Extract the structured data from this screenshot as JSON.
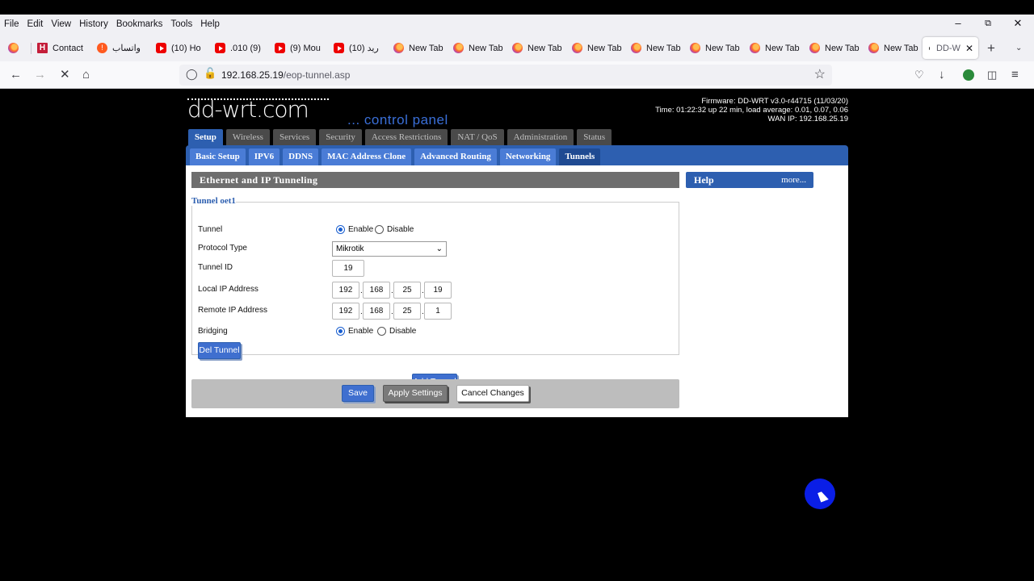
{
  "menubar": {
    "items": [
      "File",
      "Edit",
      "View",
      "History",
      "Bookmarks",
      "Tools",
      "Help"
    ]
  },
  "tabs": [
    {
      "label": "Contact",
      "icon": "h-icon"
    },
    {
      "label": "واتساب",
      "icon": "ws-icon"
    },
    {
      "label": "(10) Ho",
      "icon": "youtube-icon"
    },
    {
      "label": ".010 (9)",
      "icon": "youtube-icon"
    },
    {
      "label": "(9) Mou",
      "icon": "youtube-icon"
    },
    {
      "label": "ريد (10)",
      "icon": "youtube-icon"
    },
    {
      "label": "New Tab",
      "icon": "firefox-icon"
    },
    {
      "label": "New Tab",
      "icon": "firefox-icon"
    },
    {
      "label": "New Tab",
      "icon": "firefox-icon"
    },
    {
      "label": "New Tab",
      "icon": "firefox-icon"
    },
    {
      "label": "New Tab",
      "icon": "firefox-icon"
    },
    {
      "label": "New Tab",
      "icon": "firefox-icon"
    },
    {
      "label": "New Tab",
      "icon": "firefox-icon"
    },
    {
      "label": "New Tab",
      "icon": "firefox-icon"
    },
    {
      "label": "New Tab",
      "icon": "firefox-icon"
    }
  ],
  "active_tab": {
    "label": "DD-W"
  },
  "address": {
    "host": "192.168.25.19",
    "path": "/eop-tunnel.asp"
  },
  "header": {
    "logo": "dd-wrt.com",
    "tagline": "... control panel",
    "firmware": "Firmware: DD-WRT v3.0-r44715 (11/03/20)",
    "time": "Time: 01:22:32 up 22 min, load average: 0.01, 0.07, 0.06",
    "wan": "WAN IP: 192.168.25.19"
  },
  "main_tabs": [
    "Setup",
    "Wireless",
    "Services",
    "Security",
    "Access Restrictions",
    "NAT / QoS",
    "Administration",
    "Status"
  ],
  "sub_tabs": [
    "Basic Setup",
    "IPV6",
    "DDNS",
    "MAC Address Clone",
    "Advanced Routing",
    "Networking",
    "Tunnels"
  ],
  "section": {
    "title": "Ethernet and IP Tunneling",
    "help_title": "Help",
    "help_more": "more...",
    "legend": "Tunnel oet1"
  },
  "form": {
    "tunnel": {
      "label": "Tunnel",
      "enable": "Enable",
      "disable": "Disable",
      "value": "Enable"
    },
    "protocol": {
      "label": "Protocol Type",
      "value": "Mikrotik"
    },
    "tunnel_id": {
      "label": "Tunnel ID",
      "value": "19"
    },
    "local_ip": {
      "label": "Local IP Address",
      "octets": [
        "192",
        "168",
        "25",
        "19"
      ]
    },
    "remote_ip": {
      "label": "Remote IP Address",
      "octets": [
        "192",
        "168",
        "25",
        "1"
      ]
    },
    "bridging": {
      "label": "Bridging",
      "enable": "Enable",
      "disable": "Disable",
      "value": "Enable"
    },
    "del_button": "Del Tunnel",
    "add_button": "Add Tunnel"
  },
  "buttons": {
    "save": "Save",
    "apply": "Apply Settings",
    "cancel": "Cancel Changes"
  },
  "colors": {
    "accent": "#2d5fb0",
    "chrome": "#f0f0f4"
  }
}
